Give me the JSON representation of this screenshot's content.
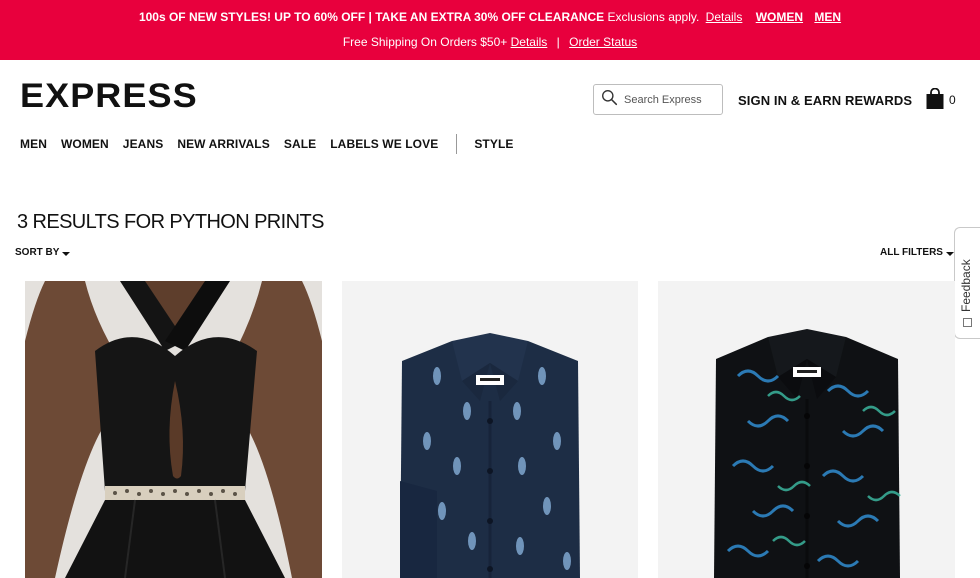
{
  "promo": {
    "line1_bold": "100s OF NEW STYLES! UP TO 60% OFF | TAKE AN EXTRA 30% OFF CLEARANCE",
    "line1_regular": "Exclusions apply.",
    "details_link": "Details",
    "women_link": "WOMEN",
    "men_link": "MEN",
    "line2_text": "Free Shipping On Orders $50+",
    "line2_details_link": "Details",
    "line2_separator": "|",
    "order_status_link": "Order Status",
    "background_color": "#e8003d"
  },
  "header": {
    "logo": "EXPRESS",
    "search_placeholder": "Search Express",
    "search_icon": "search-icon",
    "signin_label": "SIGN IN & EARN REWARDS",
    "bag_icon": "shopping-bag-icon",
    "bag_count": "0"
  },
  "nav": {
    "items": [
      "MEN",
      "WOMEN",
      "JEANS",
      "NEW ARRIVALS",
      "SALE",
      "LABELS WE LOVE"
    ],
    "style": "STYLE"
  },
  "results": {
    "title": "3 RESULTS FOR PYTHON PRINTS",
    "sort_label": "SORT BY",
    "filters_label": "ALL FILTERS"
  },
  "feedback": {
    "label": "Feedback"
  },
  "products": [
    {
      "image": "black-halter-jumpsuit-with-snakeskin-belt"
    },
    {
      "image": "navy-python-print-dress-shirt"
    },
    {
      "image": "black-python-print-dress-shirt"
    }
  ]
}
